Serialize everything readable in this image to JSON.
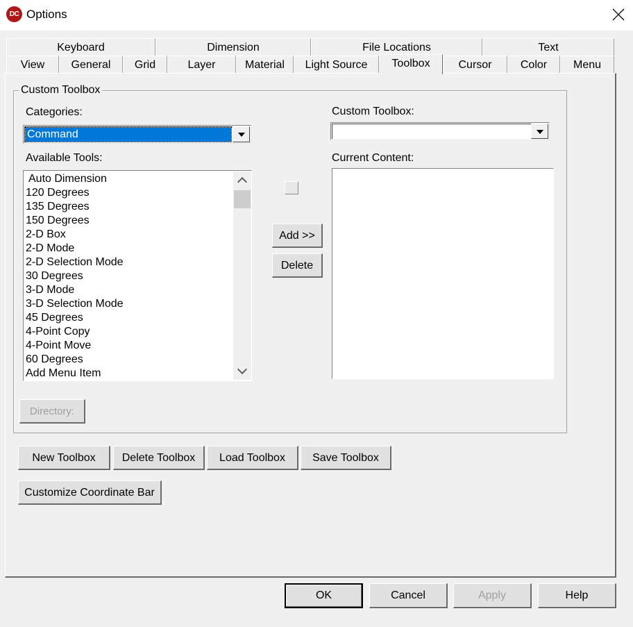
{
  "window": {
    "icon_text": "DC",
    "title": "Options",
    "close_icon": "close-icon"
  },
  "tabs_row1": [
    {
      "label": "Keyboard"
    },
    {
      "label": "Dimension"
    },
    {
      "label": "File Locations"
    },
    {
      "label": "Text"
    }
  ],
  "tabs_row2": [
    {
      "label": "View"
    },
    {
      "label": "General"
    },
    {
      "label": "Grid"
    },
    {
      "label": "Layer"
    },
    {
      "label": "Material"
    },
    {
      "label": "Light Source"
    },
    {
      "label": "Toolbox",
      "active": true
    },
    {
      "label": "Cursor"
    },
    {
      "label": "Color"
    },
    {
      "label": "Menu"
    }
  ],
  "group": {
    "title": "Custom Toolbox",
    "categories_label": "Categories:",
    "categories_value": "Command",
    "available_tools_label": "Available Tools:",
    "available_tools": [
      "Auto Dimension",
      "120 Degrees",
      "135 Degrees",
      "150 Degrees",
      "2-D Box",
      "2-D Mode",
      "2-D Selection Mode",
      "30 Degrees",
      "3-D Mode",
      "3-D Selection Mode",
      "45 Degrees",
      "4-Point Copy",
      "4-Point Move",
      "60 Degrees",
      "Add Menu Item"
    ],
    "custom_toolbox_label": "Custom Toolbox:",
    "custom_toolbox_value": "",
    "current_content_label": "Current Content:",
    "current_content": [],
    "add_button": "Add >>",
    "delete_button": "Delete",
    "directory_button": "Directory:"
  },
  "toolbox_buttons": {
    "new": "New Toolbox",
    "delete": "Delete Toolbox",
    "load": "Load Toolbox",
    "save": "Save Toolbox",
    "customize": "Customize Coordinate Bar"
  },
  "footer": {
    "ok": "OK",
    "cancel": "Cancel",
    "apply": "Apply",
    "help": "Help"
  },
  "colors": {
    "selection": "#0078d7",
    "app_icon": "#b01717"
  }
}
